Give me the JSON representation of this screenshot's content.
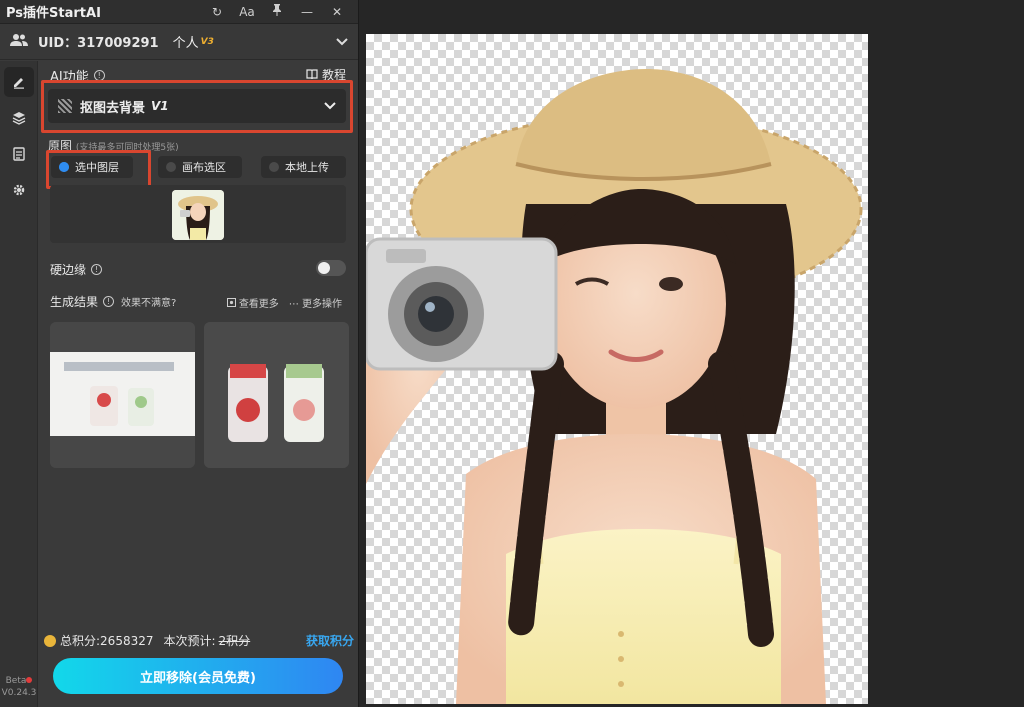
{
  "app": {
    "title": "Ps插件StartAI"
  },
  "titlebar": {
    "refresh_icon": "↻",
    "font_icon": "Aa",
    "pin_icon": "📌",
    "minimize_icon": "—",
    "close_icon": "✕"
  },
  "user": {
    "uid_label": "UID：317009291",
    "tier": "个人",
    "tier_badge": "V3"
  },
  "sidebar": {
    "version_beta": "Beta",
    "version_number": "V0.24.3"
  },
  "ai": {
    "section_label": "AI功能",
    "tutorial_label": "教程",
    "selected_feature": "抠图去背景",
    "feature_version": "V1"
  },
  "source": {
    "label": "原图",
    "hint": "(支持最多可同时处理5张)",
    "options": [
      "选中图层",
      "画布选区",
      "本地上传"
    ],
    "selected": "选中图层"
  },
  "hard_edge": {
    "label": "硬边缘",
    "enabled": false
  },
  "results": {
    "label": "生成结果",
    "feedback": "效果不满意?",
    "view_more": "查看更多",
    "more_actions": "更多操作"
  },
  "points": {
    "total": "总积分:2658327",
    "estimate_label": "本次预计:",
    "estimate_value": "2积分",
    "get_points": "获取积分"
  },
  "cta": {
    "label": "立即移除(会员免费)"
  },
  "colors": {
    "accent_red": "#d9462f",
    "cta_start": "#12d8ea",
    "cta_end": "#2f86f2",
    "link_blue": "#38a7f0"
  }
}
